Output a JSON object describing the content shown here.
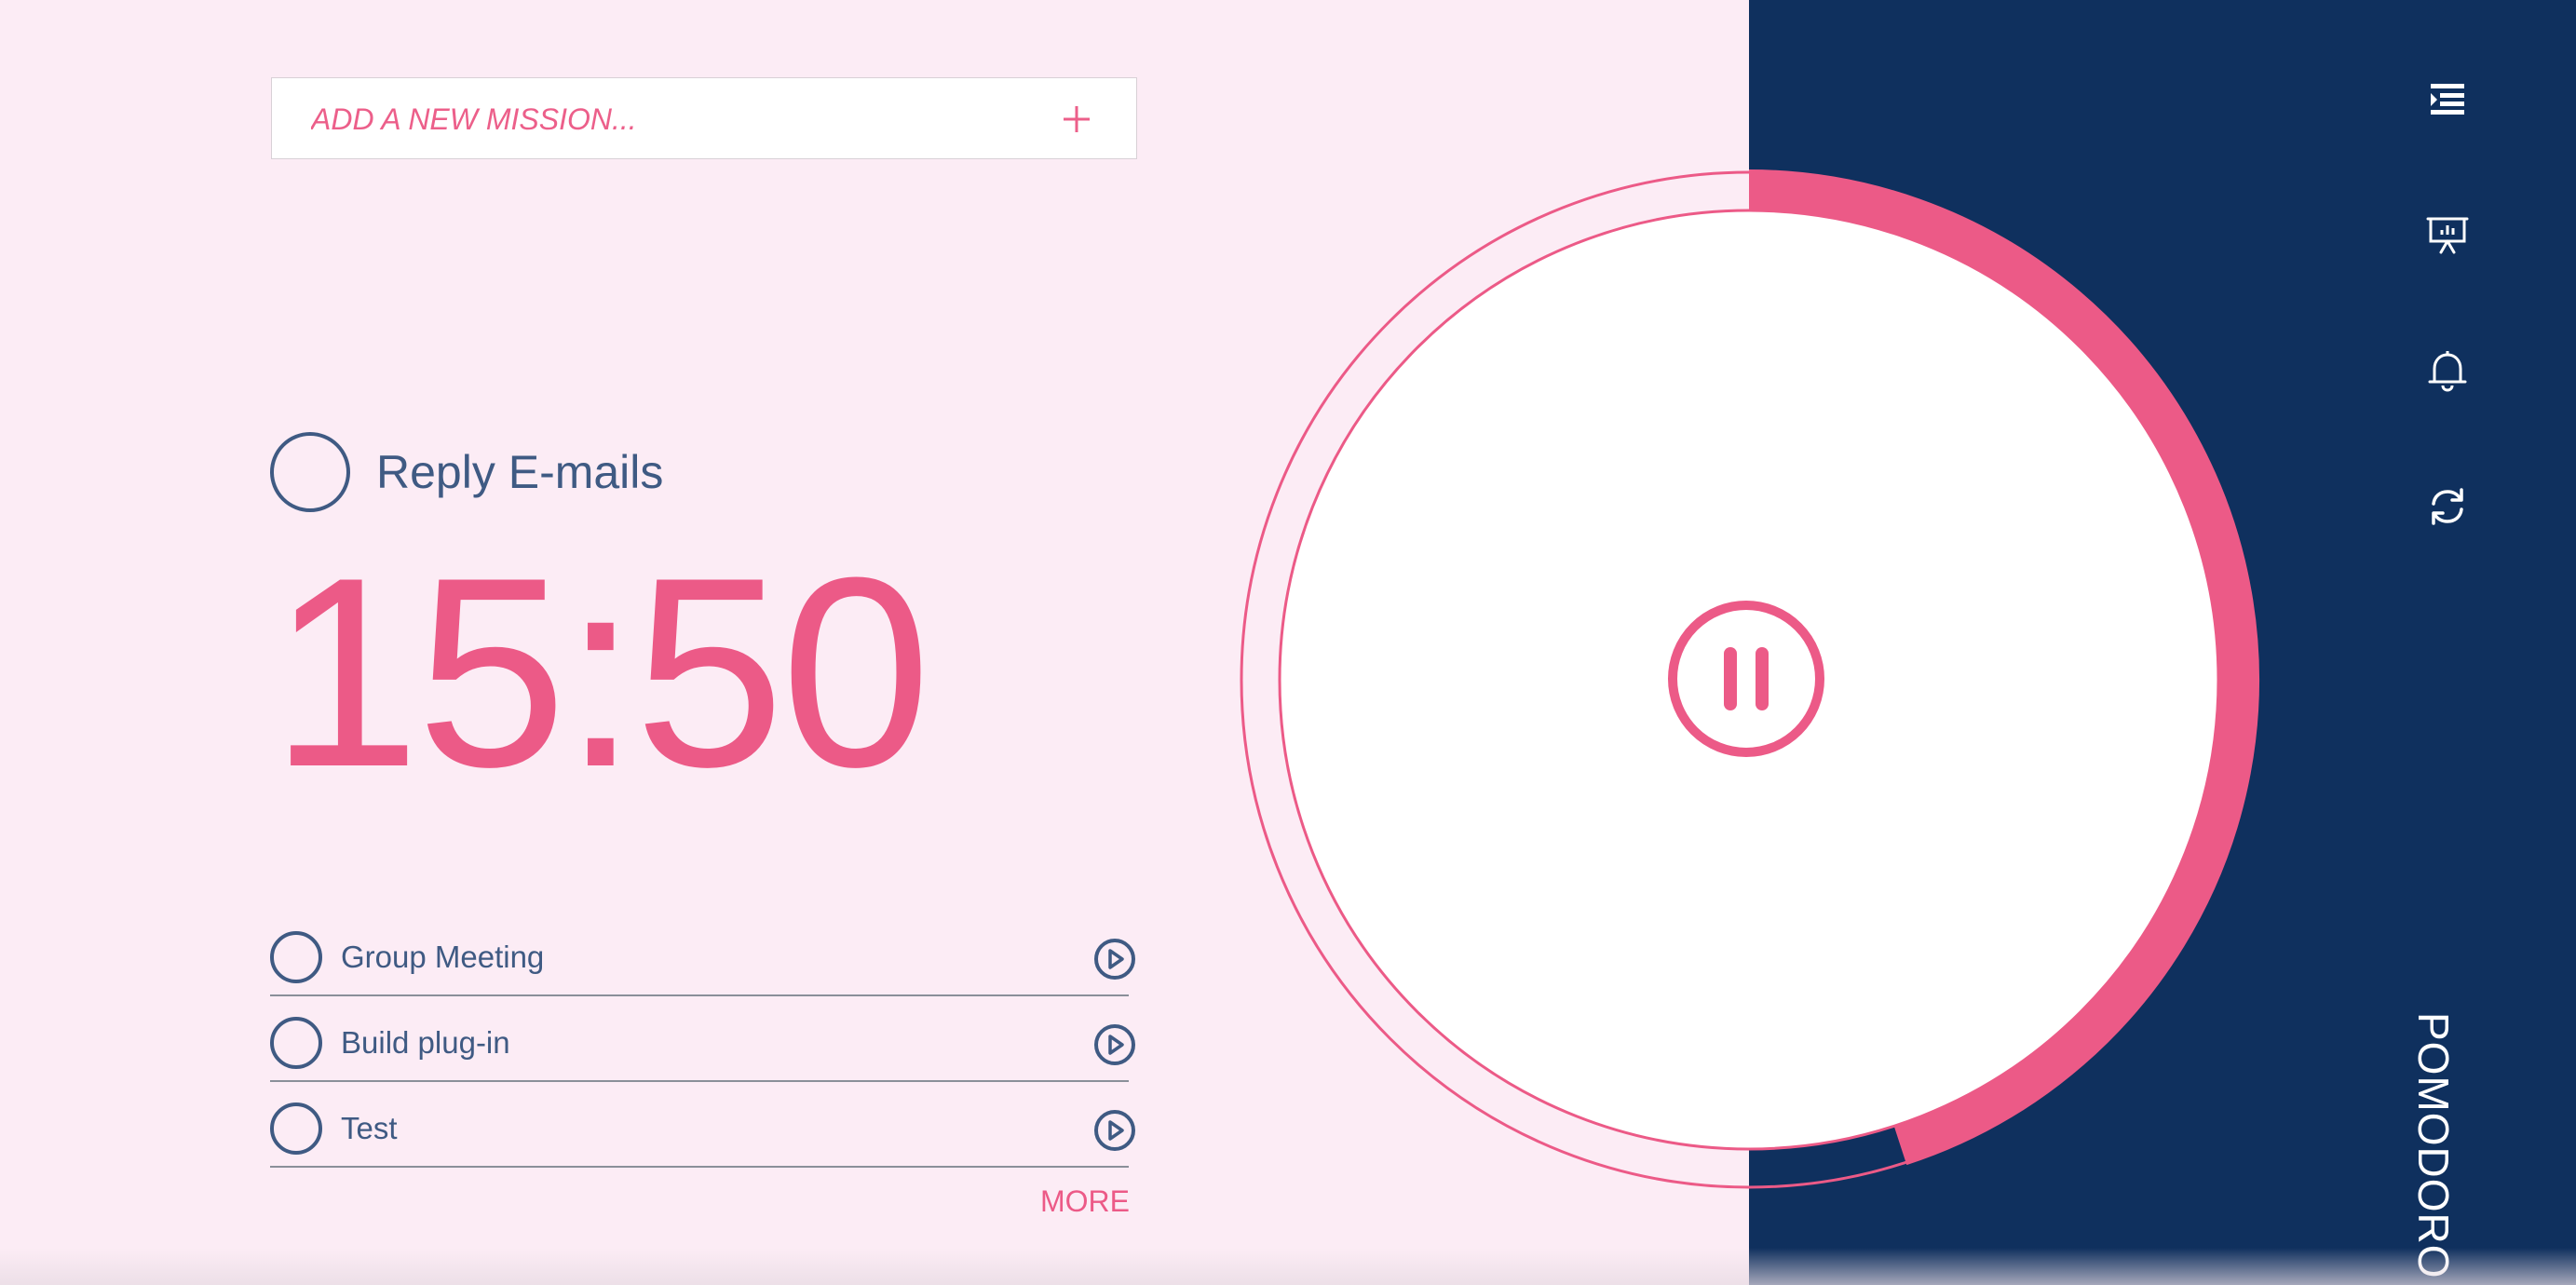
{
  "add_mission": {
    "placeholder": "ADD A NEW MISSION..."
  },
  "current_task": {
    "title": "Reply E-mails",
    "timer": "15:50"
  },
  "tasks": [
    {
      "label": "Group Meeting"
    },
    {
      "label": "Build plug-in"
    },
    {
      "label": "Test"
    }
  ],
  "more_label": "MORE",
  "timer_progress": 0.45,
  "sidebar": {
    "icons": [
      "task-list-icon",
      "statistics-icon",
      "bell-icon",
      "refresh-icon"
    ],
    "brand": "POMODORO"
  },
  "colors": {
    "accent": "#ec5a87",
    "navy": "#0f305e",
    "text": "#3f5a83",
    "background": "#fcecf5"
  }
}
